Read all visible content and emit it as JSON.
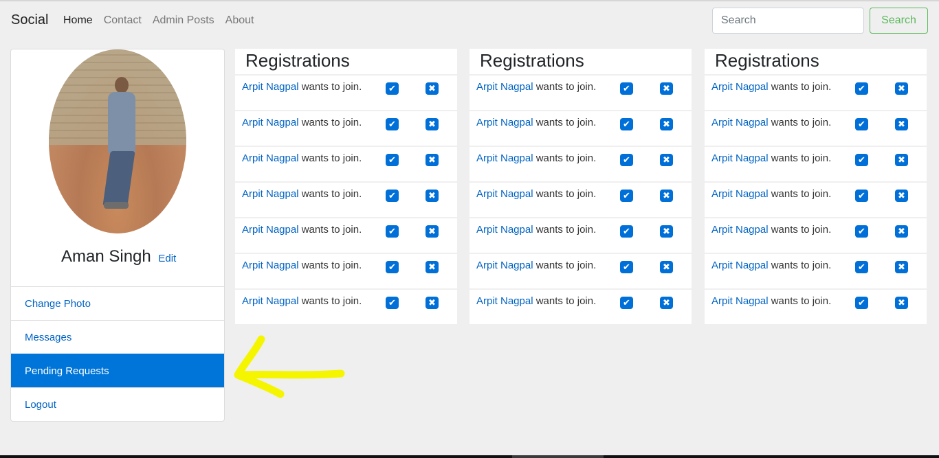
{
  "navbar": {
    "brand": "Social",
    "links": [
      "Home",
      "Contact",
      "Admin Posts",
      "About"
    ],
    "search_placeholder": "Search",
    "search_button": "Search"
  },
  "profile": {
    "name": "Aman Singh",
    "edit_label": "Edit",
    "menu": [
      "Change Photo",
      "Messages",
      "Pending Requests",
      "Logout"
    ],
    "active_menu": "Pending Requests"
  },
  "panels": [
    {
      "title": "Registrations",
      "requests": [
        {
          "name": "Arpit Nagpal",
          "text": " wants to join."
        },
        {
          "name": "Arpit Nagpal",
          "text": " wants to join."
        },
        {
          "name": "Arpit Nagpal",
          "text": " wants to join."
        },
        {
          "name": "Arpit Nagpal",
          "text": " wants to join."
        },
        {
          "name": "Arpit Nagpal",
          "text": " wants to join."
        },
        {
          "name": "Arpit Nagpal",
          "text": " wants to join."
        },
        {
          "name": "Arpit Nagpal",
          "text": " wants to join."
        }
      ]
    },
    {
      "title": "Registrations",
      "requests": [
        {
          "name": "Arpit Nagpal",
          "text": " wants to join."
        },
        {
          "name": "Arpit Nagpal",
          "text": " wants to join."
        },
        {
          "name": "Arpit Nagpal",
          "text": " wants to join."
        },
        {
          "name": "Arpit Nagpal",
          "text": " wants to join."
        },
        {
          "name": "Arpit Nagpal",
          "text": " wants to join."
        },
        {
          "name": "Arpit Nagpal",
          "text": " wants to join."
        },
        {
          "name": "Arpit Nagpal",
          "text": " wants to join."
        }
      ]
    },
    {
      "title": "Registrations",
      "requests": [
        {
          "name": "Arpit Nagpal",
          "text": " wants to join."
        },
        {
          "name": "Arpit Nagpal",
          "text": " wants to join."
        },
        {
          "name": "Arpit Nagpal",
          "text": " wants to join."
        },
        {
          "name": "Arpit Nagpal",
          "text": " wants to join."
        },
        {
          "name": "Arpit Nagpal",
          "text": " wants to join."
        },
        {
          "name": "Arpit Nagpal",
          "text": " wants to join."
        },
        {
          "name": "Arpit Nagpal",
          "text": " wants to join."
        }
      ]
    }
  ],
  "icons": {
    "accept": "check-square-icon",
    "reject": "x-square-icon",
    "annotation": "yellow-arrow-icon"
  },
  "colors": {
    "link": "#0063c4",
    "active_menu_bg": "#0075d9",
    "search_button": "#5cb85c",
    "annotation_arrow": "#f5f500"
  }
}
